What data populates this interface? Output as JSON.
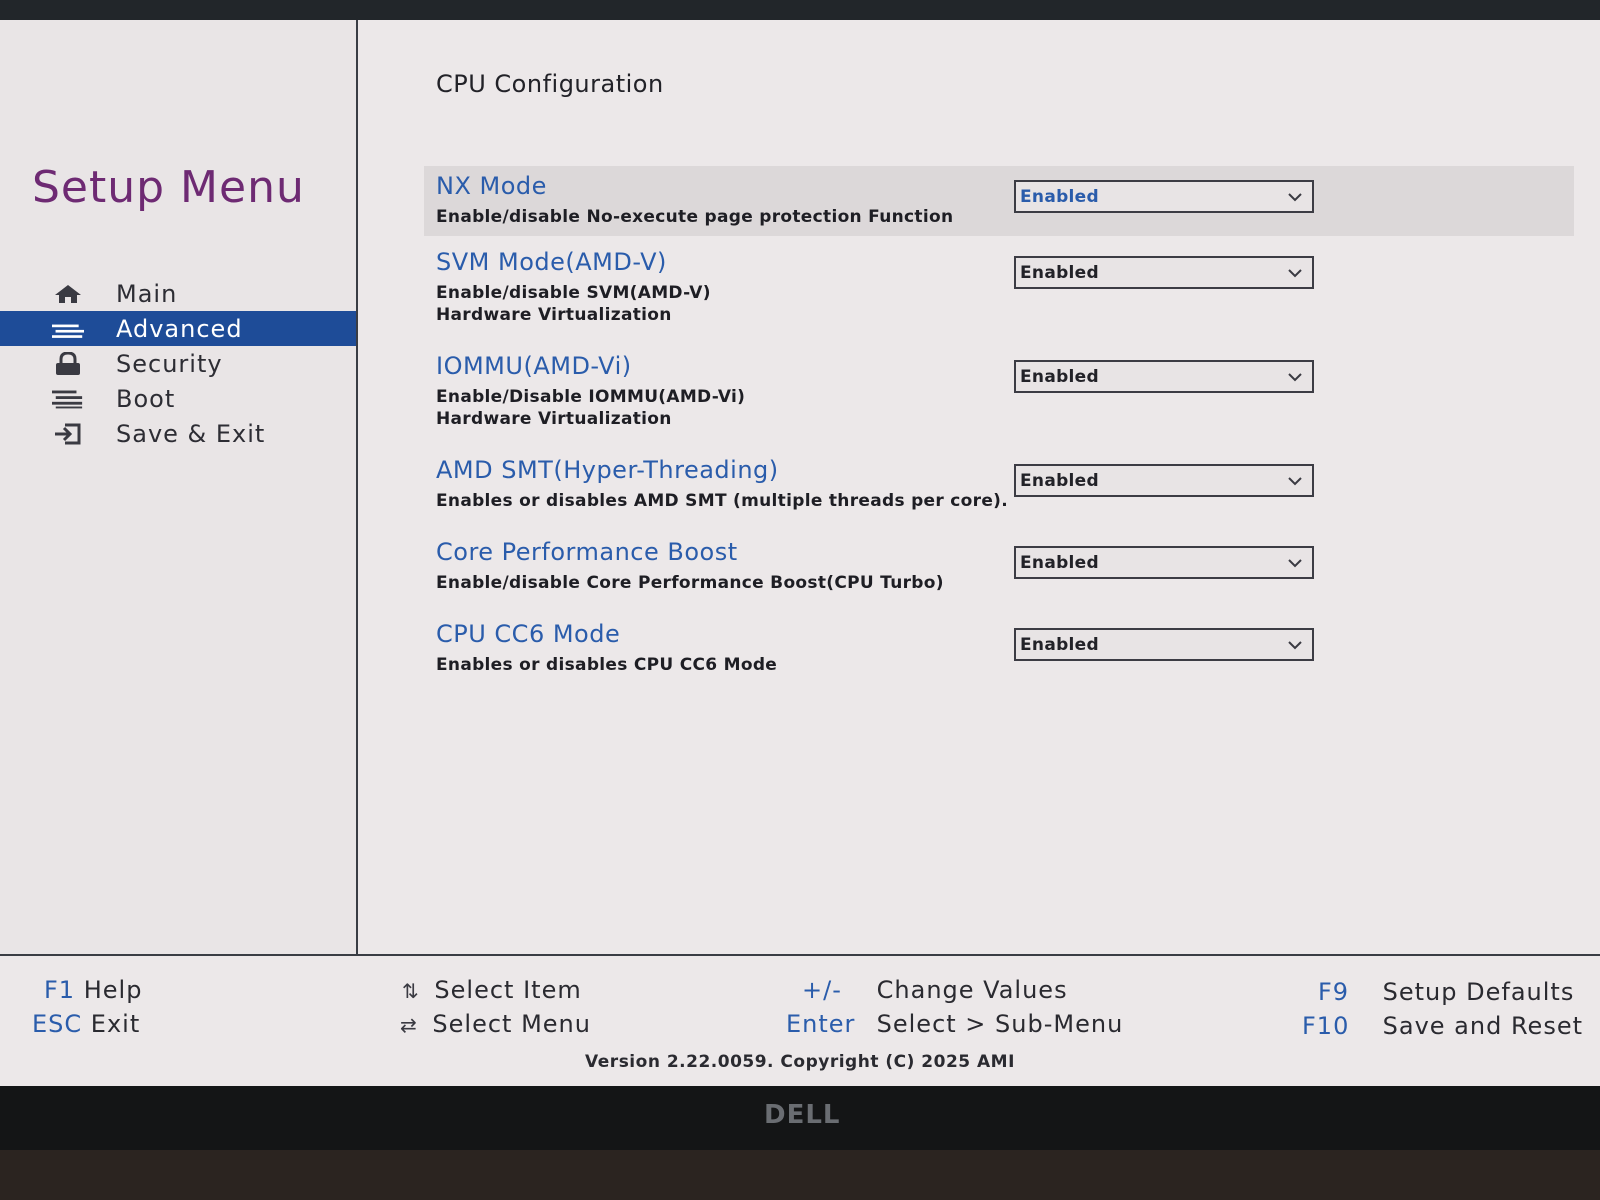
{
  "sidebar": {
    "title": "Setup Menu",
    "items": [
      {
        "label": "Main",
        "icon": "home-icon"
      },
      {
        "label": "Advanced",
        "icon": "advanced-icon",
        "active": true
      },
      {
        "label": "Security",
        "icon": "lock-icon"
      },
      {
        "label": "Boot",
        "icon": "boot-icon"
      },
      {
        "label": "Save & Exit",
        "icon": "exit-icon"
      }
    ]
  },
  "main": {
    "title": "CPU Configuration",
    "settings": [
      {
        "name": "NX Mode",
        "description": "Enable/disable No-execute page protection Function",
        "value": "Enabled",
        "selected": true
      },
      {
        "name": "SVM Mode(AMD-V)",
        "description": "Enable/disable SVM(AMD-V)\nHardware Virtualization",
        "value": "Enabled"
      },
      {
        "name": "IOMMU(AMD-Vi)",
        "description": "Enable/Disable IOMMU(AMD-Vi)\nHardware Virtualization",
        "value": "Enabled"
      },
      {
        "name": "AMD SMT(Hyper-Threading)",
        "description": "Enables or disables AMD SMT (multiple threads per core).",
        "value": "Enabled"
      },
      {
        "name": "Core Performance Boost",
        "description": "Enable/disable Core Performance Boost(CPU Turbo)",
        "value": "Enabled"
      },
      {
        "name": "CPU CC6 Mode",
        "description": "Enables or disables CPU CC6 Mode",
        "value": "Enabled"
      }
    ]
  },
  "footer": {
    "keys": [
      {
        "key": "F1",
        "label": "Help"
      },
      {
        "key": "ESC",
        "label": "Exit"
      },
      {
        "key": "⇅",
        "label": "Select Item"
      },
      {
        "key": "⇄",
        "label": "Select Menu"
      },
      {
        "key": "+/-",
        "label": "Change Values"
      },
      {
        "key": "Enter",
        "label": "Select > Sub-Menu"
      },
      {
        "key": "F9",
        "label": "Setup Defaults"
      },
      {
        "key": "F10",
        "label": "Save and Reset"
      }
    ],
    "version": "Version 2.22.0059. Copyright (C) 2025 AMI"
  },
  "monitor": {
    "brand": "DELL"
  },
  "colors": {
    "accent": "#2a5cab",
    "title": "#6e2a73",
    "active_bg": "#1e4c98",
    "background": "#ece8e9"
  }
}
